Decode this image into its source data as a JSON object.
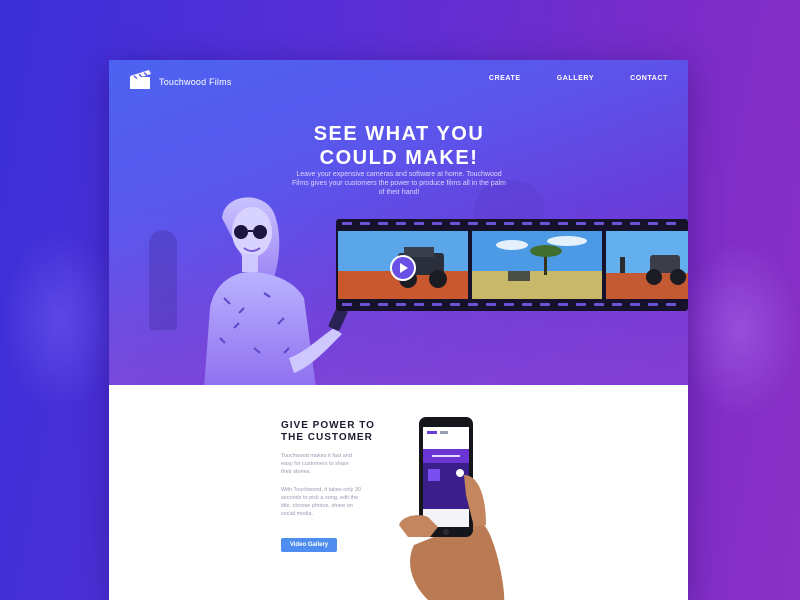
{
  "brand": {
    "name": "Touchwood Films"
  },
  "nav": {
    "items": [
      "CREATE",
      "GALLERY",
      "CONTACT"
    ]
  },
  "hero": {
    "title_line1": "SEE WHAT YOU",
    "title_line2": "COULD MAKE!",
    "subtitle": "Leave your expensive cameras and software at home. Touchwood Films gives your customers the power to produce films all in the palm of their hand!"
  },
  "section": {
    "title_line1": "GIVE POWER TO",
    "title_line2": "THE CUSTOMER",
    "para1": "Touchwood makes it fast and easy for customers to share their stories.",
    "para2": "With Touchwood, it takes only 30 seconds to pick a song, edit the title, choose photos, share on social media.",
    "button_label": "Video Gallery"
  },
  "colors": {
    "accent": "#4f8ef0",
    "hero_start": "#4c63f0",
    "hero_end": "#7a2fcf",
    "play": "#6a4fe6"
  }
}
